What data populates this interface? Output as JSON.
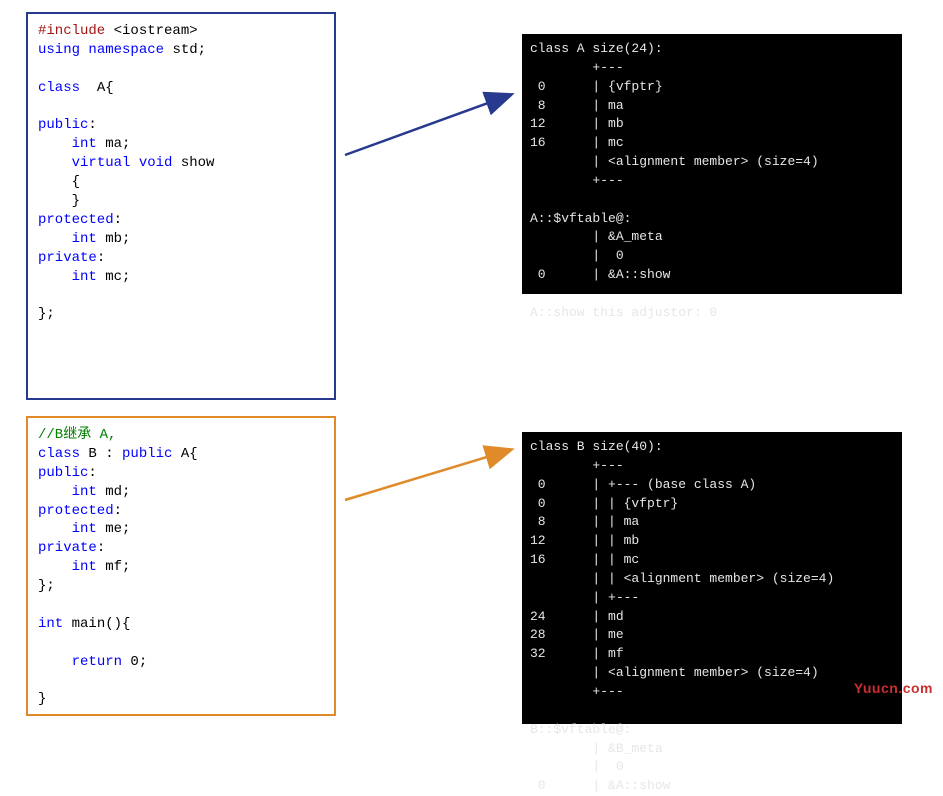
{
  "codeA": {
    "l1a": "#include",
    "l1b": " <iostream>",
    "l2a": "using",
    "l2b": " ",
    "l2c": "namespace",
    "l2d": " std;",
    "l4a": "class",
    "l4b": "  A{",
    "l6a": "public",
    "l6b": ":",
    "l7a": "    ",
    "l7b": "int",
    "l7c": " ma;",
    "l8a": "    ",
    "l8b": "virtual",
    "l8c": " ",
    "l8d": "void",
    "l8e": " show",
    "l9": "    {",
    "l10": "    }",
    "l11a": "protected",
    "l11b": ":",
    "l12a": "    ",
    "l12b": "int",
    "l12c": " mb;",
    "l13a": "private",
    "l13b": ":",
    "l14a": "    ",
    "l14b": "int",
    "l14c": " mc;",
    "l16": "};"
  },
  "codeB": {
    "c1": "//B继承 A,",
    "l1a": "class",
    "l1b": " B : ",
    "l1c": "public",
    "l1d": " A{",
    "l2a": "public",
    "l2b": ":",
    "l3a": "    ",
    "l3b": "int",
    "l3c": " md;",
    "l4a": "protected",
    "l4b": ":",
    "l5a": "    ",
    "l5b": "int",
    "l5c": " me;",
    "l6a": "private",
    "l6b": ":",
    "l7a": "    ",
    "l7b": "int",
    "l7c": " mf;",
    "l8": "};",
    "m1a": "int",
    "m1b": " main(){",
    "m3a": "    ",
    "m3b": "return",
    "m3c": " 0;",
    "m5": "}"
  },
  "termA": {
    "t1": "class A size(24):",
    "t2": "        +---",
    "t3": " 0      | {vfptr}",
    "t4": " 8      | ma",
    "t5": "12      | mb",
    "t6": "16      | mc",
    "t7": "        | <alignment member> (size=4)",
    "t8": "        +---",
    "t9": "",
    "t10": "A::$vftable@:",
    "t11": "        | &A_meta",
    "t12": "        |  0",
    "t13": " 0      | &A::show",
    "t14": "",
    "t15": "A::show this adjustor: 0"
  },
  "termB": {
    "t1": "class B size(40):",
    "t2": "        +---",
    "t3": " 0      | +--- (base class A)",
    "t4": " 0      | | {vfptr}",
    "t5": " 8      | | ma",
    "t6": "12      | | mb",
    "t7": "16      | | mc",
    "t8": "        | | <alignment member> (size=4)",
    "t9": "        | +---",
    "t10": "24      | md",
    "t11": "28      | me",
    "t12": "32      | mf",
    "t13": "        | <alignment member> (size=4)",
    "t14": "        +---",
    "t15": "",
    "t16": "B::$vftable@:",
    "t17": "        | &B_meta",
    "t18": "        |  0",
    "t19": " 0      | &A::show"
  },
  "watermark": "Yuucn.com",
  "colors": {
    "blueBorder": "#283a8f",
    "orangeBorder": "#e08a2a"
  }
}
